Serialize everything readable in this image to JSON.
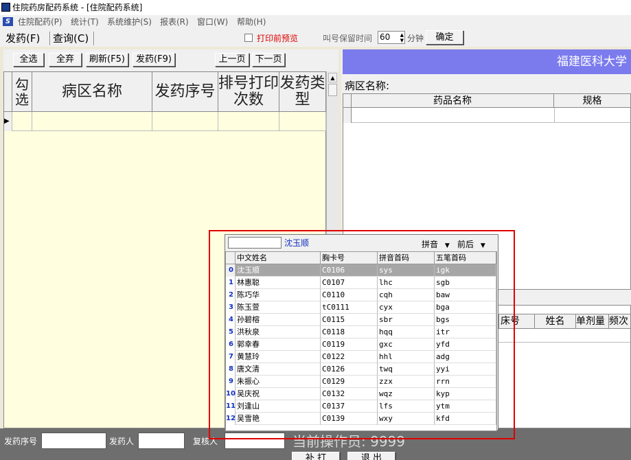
{
  "window": {
    "title": "住院药房配药系统 - [住院配药系统]"
  },
  "menu": [
    "住院配药(P)",
    "统计(T)",
    "系统维护(S)",
    "报表(R)",
    "窗口(W)",
    "帮助(H)"
  ],
  "tabs": [
    {
      "label": "发药(F)"
    },
    {
      "label": "查询(C)"
    }
  ],
  "options": {
    "print_preview_label": "打印前预览",
    "call_hold_label": "叫号保留时间",
    "call_hold_value": "60",
    "minutes_label": "分钟",
    "confirm_label": "确定"
  },
  "toolbar": {
    "select_all": "全选",
    "discard_all": "全弃",
    "refresh": "刷新(F5)",
    "dispense": "发药(F9)",
    "prev_page": "上一页",
    "next_page": "下一页"
  },
  "ward_grid": {
    "columns": [
      "勾选",
      "病区名称",
      "发药序号",
      "排号打印次数",
      "发药类型"
    ]
  },
  "right": {
    "banner": "福建医科大学",
    "ward_label": "病区名称:",
    "drug_columns": [
      "药品名称",
      "规格"
    ],
    "patient_columns": [
      "床号",
      "姓名",
      "单剂量",
      "频次"
    ]
  },
  "bottom": {
    "seq_label": "发药序号",
    "seq_value": "",
    "dispenser_label": "发药人",
    "dispenser_value": "",
    "reviewer_label": "复核人",
    "reviewer_value": "",
    "operator_text": "当前操作员:  9999",
    "reprint_label": "补  打",
    "exit_label": "退  出"
  },
  "popup": {
    "search_value": "",
    "selected_name": "沈玉顺",
    "mode_pinyin": "拼音",
    "mode_order": "前后",
    "columns": [
      "中文姓名",
      "胸卡号",
      "拼音首码",
      "五笔首码"
    ],
    "rows": [
      {
        "idx": "0",
        "name": "沈玉顺",
        "card": "C0106",
        "py": "sys",
        "wb": "igk"
      },
      {
        "idx": "1",
        "name": "林惠聪",
        "card": "C0107",
        "py": "lhc",
        "wb": "sgb"
      },
      {
        "idx": "2",
        "name": "陈巧华",
        "card": "C0110",
        "py": "cqh",
        "wb": "baw"
      },
      {
        "idx": "3",
        "name": "陈玉萱",
        "card": "tC0111",
        "py": "cyx",
        "wb": "bga"
      },
      {
        "idx": "4",
        "name": "孙碧榕",
        "card": "C0115",
        "py": "sbr",
        "wb": "bgs"
      },
      {
        "idx": "5",
        "name": "洪秋泉",
        "card": "C0118",
        "py": "hqq",
        "wb": "itr"
      },
      {
        "idx": "6",
        "name": "郭幸春",
        "card": "C0119",
        "py": "gxc",
        "wb": "yfd"
      },
      {
        "idx": "7",
        "name": "黄慧玲",
        "card": "C0122",
        "py": "hhl",
        "wb": "adg"
      },
      {
        "idx": "8",
        "name": "唐文清",
        "card": "C0126",
        "py": "twq",
        "wb": "yyi"
      },
      {
        "idx": "9",
        "name": "朱振心",
        "card": "C0129",
        "py": "zzx",
        "wb": "rrn"
      },
      {
        "idx": "10",
        "name": "吴庆祝",
        "card": "C0132",
        "py": "wqz",
        "wb": "kyp"
      },
      {
        "idx": "11",
        "name": "刘逢山",
        "card": "C0137",
        "py": "lfs",
        "wb": "ytm"
      },
      {
        "idx": "12",
        "name": "吴雪艳",
        "card": "C0139",
        "py": "wxy",
        "wb": "kfd"
      }
    ]
  },
  "colors": {
    "banner": "#7b7bee",
    "grid_bg": "#ffffe0",
    "highlight": "#e00000",
    "selected_row": "#a6a6a6"
  }
}
